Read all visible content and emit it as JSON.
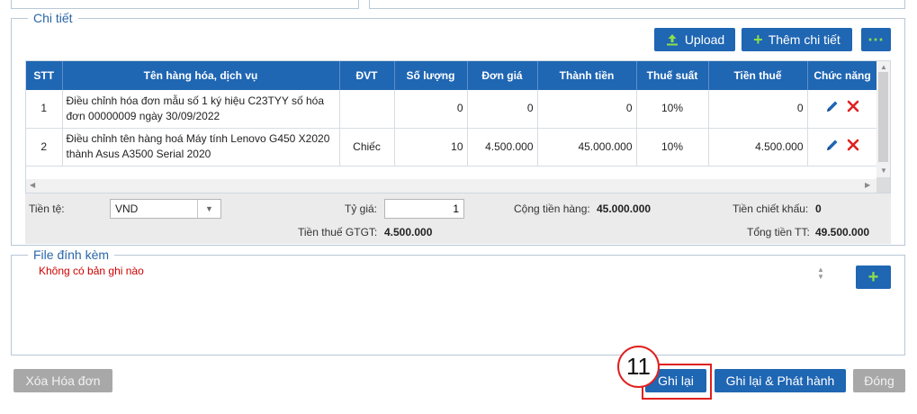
{
  "detail_section": {
    "legend": "Chi tiết",
    "upload_label": "Upload",
    "add_detail_label": "Thêm chi tiết",
    "more_label": "⋯"
  },
  "table": {
    "headers": [
      "STT",
      "Tên hàng hóa, dịch vụ",
      "ĐVT",
      "Số lượng",
      "Đơn giá",
      "Thành tiền",
      "Thuế suất",
      "Tiền thuế",
      "Chức năng"
    ],
    "rows": [
      {
        "stt": "1",
        "name": "Điều chỉnh hóa đơn mẫu số 1 ký hiệu C23TYY số hóa đơn 00000009 ngày 30/09/2022",
        "unit": "",
        "qty": "0",
        "price": "0",
        "amount": "0",
        "rate": "10%",
        "tax": "0"
      },
      {
        "stt": "2",
        "name": "Điều chỉnh tên hàng hoá Máy tính Lenovo G450 X2020 thành Asus A3500 Serial 2020",
        "unit": "Chiếc",
        "qty": "10",
        "price": "4.500.000",
        "amount": "45.000.000",
        "rate": "10%",
        "tax": "4.500.000"
      }
    ]
  },
  "summary": {
    "currency_label": "Tiền tệ:",
    "currency_value": "VND",
    "rate_label": "Tỷ giá:",
    "rate_value": "1",
    "goods_total_label": "Cộng tiền hàng:",
    "goods_total_value": "45.000.000",
    "discount_label": "Tiền chiết khấu:",
    "discount_value": "0",
    "vat_label": "Tiền thuế GTGT:",
    "vat_value": "4.500.000",
    "grand_total_label": "Tổng tiền TT:",
    "grand_total_value": "49.500.000"
  },
  "attachment_section": {
    "legend": "File đính kèm",
    "empty_message": "Không có bản ghi nào",
    "add_label": "+"
  },
  "footer": {
    "delete_label": "Xóa Hóa đơn",
    "save_label": "Ghi lại",
    "save_publish_label": "Ghi lại & Phát hành",
    "close_label": "Đóng"
  },
  "annotation": {
    "step_number": "11"
  },
  "colors": {
    "primary": "#1f66b3",
    "accent_green": "#8de04a",
    "highlight_red": "#e0201f",
    "delete_red": "#e02020",
    "disabled_gray": "#a8a8a8"
  }
}
